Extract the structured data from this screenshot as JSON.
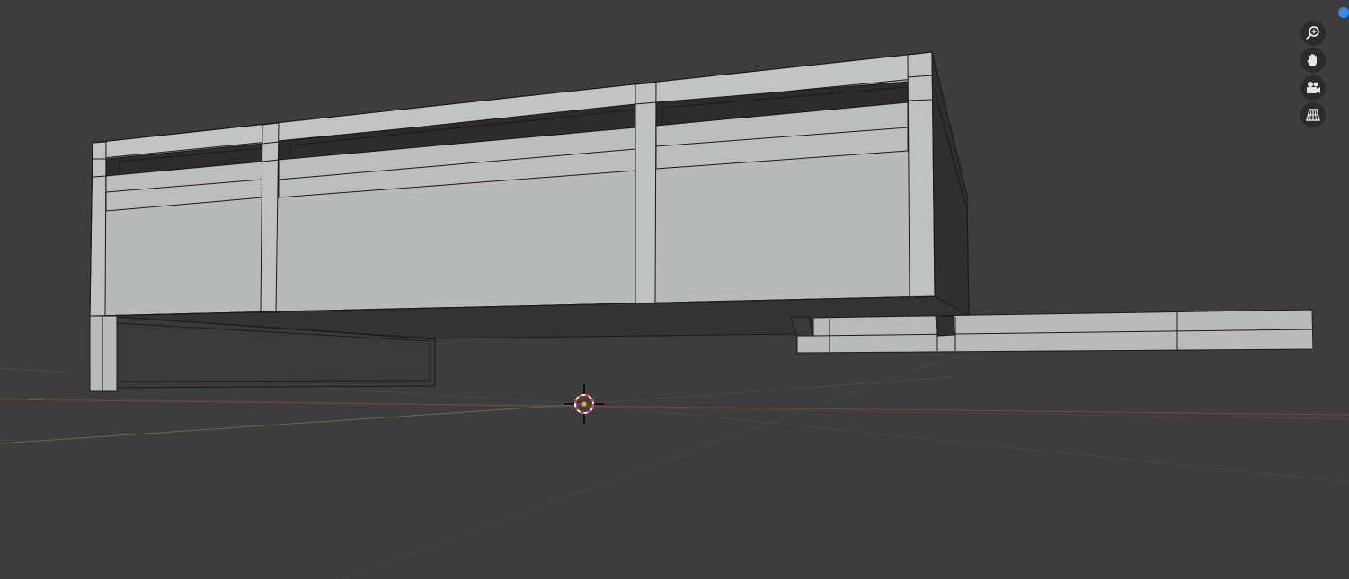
{
  "viewport": {
    "background": "#3d3d3d",
    "grid_color": "#474747",
    "x_axis_color": "#7a4646",
    "y_axis_color": "#5c7048",
    "mesh_face_color": "#b9baba",
    "mesh_dark_color": "#2f2f2f",
    "mesh_edge_color": "#1a1a1a",
    "cursor_colors": [
      "#e03a3a",
      "#ffffff"
    ]
  },
  "navigation": {
    "tools": [
      {
        "name": "zoom",
        "icon": "zoom-in-icon"
      },
      {
        "name": "pan",
        "icon": "hand-icon"
      },
      {
        "name": "camera",
        "icon": "camera-icon"
      },
      {
        "name": "perspective",
        "icon": "grid-perspective-icon"
      }
    ],
    "gizmo_dot_color": "#2f8cff"
  }
}
